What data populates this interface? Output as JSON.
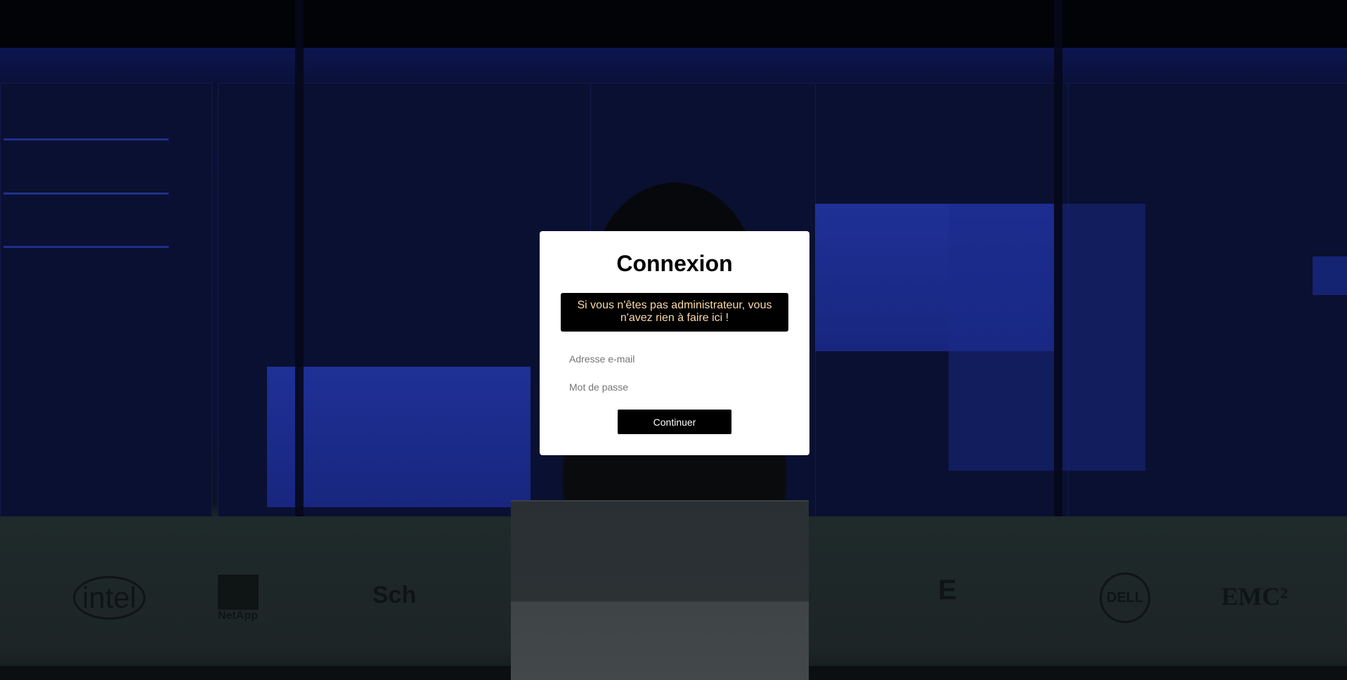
{
  "login": {
    "title": "Connexion",
    "warning": "Si vous n'êtes pas administrateur, vous n'avez rien à faire ici !",
    "email_placeholder": "Adresse e-mail",
    "password_placeholder": "Mot de passe",
    "submit_label": "Continuer"
  },
  "background": {
    "logos": [
      "intel",
      "NetApp",
      "Sch",
      "E",
      "DELL",
      "EMC²"
    ]
  },
  "colors": {
    "modal_background": "#ffffff",
    "warning_background": "#000000",
    "warning_text": "#ffd9a8",
    "button_background": "#000000",
    "button_text": "#ffffff"
  }
}
